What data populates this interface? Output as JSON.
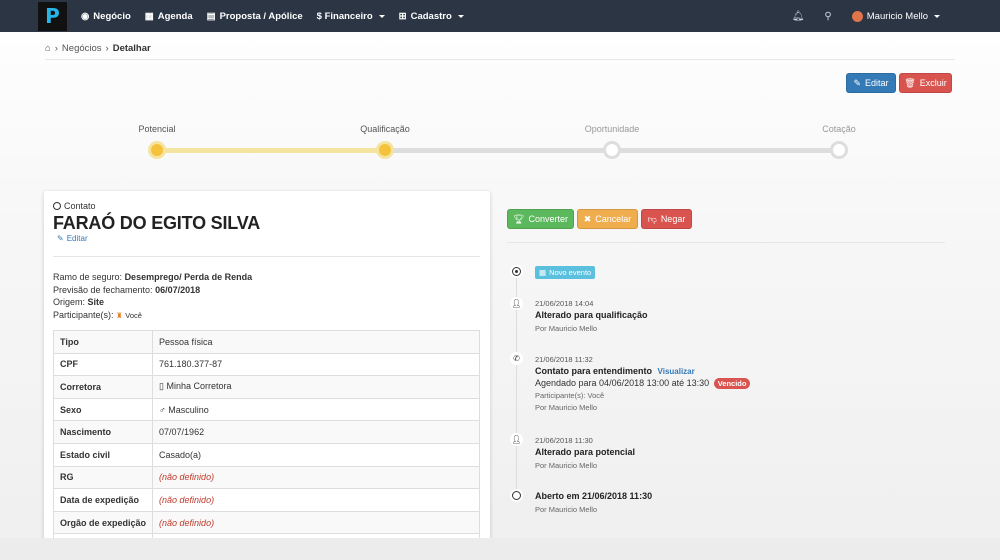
{
  "nav": {
    "logo_letter": "P",
    "items": [
      {
        "icon": "eye-icon",
        "label": "Negócio"
      },
      {
        "icon": "calendar-icon",
        "label": "Agenda"
      },
      {
        "icon": "document-icon",
        "label": "Proposta / Apólice"
      },
      {
        "icon": "dollar-icon",
        "label": "$ Financeiro"
      },
      {
        "icon": "plus-square-icon",
        "label": "Cadastro"
      }
    ],
    "user_name": "Mauricio Mello"
  },
  "breadcrumb": {
    "level1": "Negócios",
    "current": "Detalhar"
  },
  "actions": {
    "edit": "Editar",
    "delete": "Excluir"
  },
  "stages": [
    "Potencial",
    "Qualificação",
    "Oportunidade",
    "Cotação"
  ],
  "stages_completed": 2,
  "contact": {
    "label": "Contato",
    "name": "FARAÓ DO EGITO SILVA",
    "edit": "Editar",
    "ramo_label": "Ramo de seguro:",
    "ramo_value": "Desemprego/ Perda de Renda",
    "previsao_label": "Previsão de fechamento:",
    "previsao_value": "06/07/2018",
    "origem_label": "Origem:",
    "origem_value": "Site",
    "participantes_label": "Participante(s):",
    "participantes_value": "Você"
  },
  "details": [
    {
      "label": "Tipo",
      "value": "Pessoa física"
    },
    {
      "label": "CPF",
      "value": "761.180.377-87"
    },
    {
      "label": "Corretora",
      "value": "Minha Corretora"
    },
    {
      "label": "Sexo",
      "value": "Masculino"
    },
    {
      "label": "Nascimento",
      "value": "07/07/1962"
    },
    {
      "label": "Estado civil",
      "value": "Casado(a)"
    },
    {
      "label": "RG",
      "value": "(não definido)"
    },
    {
      "label": "Data de expedição",
      "value": "(não definido)"
    },
    {
      "label": "Orgão de expedição",
      "value": "(não definido)"
    },
    {
      "label": "",
      "value": ""
    }
  ],
  "deal_actions": {
    "convert": "Converter",
    "cancel": "Cancelar",
    "deny": "Negar"
  },
  "timeline": {
    "new_event": "Novo evento",
    "events": [
      {
        "date": "21/06/2018 14:04",
        "title": "Alterado para qualificação",
        "by": "Por Mauricio Mello"
      },
      {
        "date": "21/06/2018 11:32",
        "title": "Contato para entendimento",
        "link": "Visualizar",
        "scheduled_prefix": "Agendado para 04/06/2018",
        "scheduled_time": "13:00 até 13:30",
        "late": "Vencido",
        "participants": "Participante(s): Você",
        "by": "Por Mauricio Mello"
      },
      {
        "date": "21/06/2018 11:30",
        "title": "Alterado para potencial",
        "by": "Por Mauricio Mello"
      },
      {
        "title": "Aberto em 21/06/2018 11:30",
        "by": "Por Mauricio Mello"
      }
    ]
  }
}
